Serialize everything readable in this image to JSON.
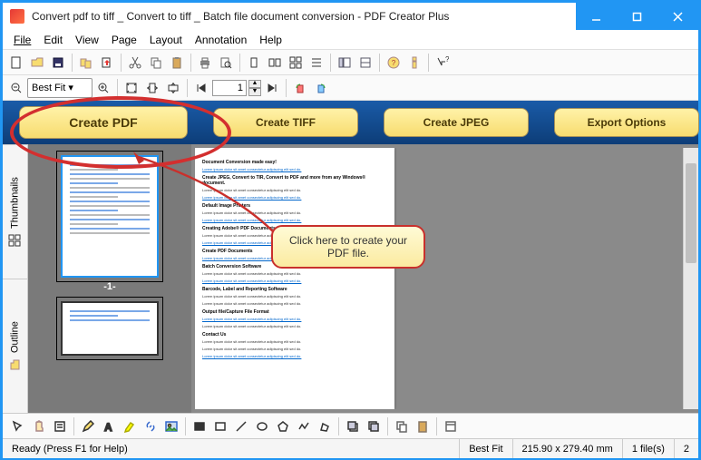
{
  "window": {
    "title": "Convert pdf to tiff _ Convert to tiff _ Batch file document conversion - PDF Creator Plus"
  },
  "menu": {
    "file": "File",
    "edit": "Edit",
    "view": "View",
    "page": "Page",
    "layout": "Layout",
    "annotation": "Annotation",
    "help": "Help"
  },
  "toolbar2": {
    "page_value": "1"
  },
  "actions": {
    "create_pdf": "Create PDF",
    "create_tiff": "Create TIFF",
    "create_jpeg": "Create JPEG",
    "export_options": "Export Options"
  },
  "side_tabs": {
    "thumbnails": "Thumbnails",
    "outline": "Outline"
  },
  "thumbs": {
    "page1_label": "-1-"
  },
  "callout": {
    "text": "Click here to create your PDF file."
  },
  "doc": {
    "h1": "Document Conversion made easy!",
    "h2": "Create JPEG, Convert to TIR, Convert to PDF and more from any Windows® document.",
    "p1": "Lorem ipsum dolor sit amet consectetur adipiscing elit sed do.",
    "h3": "Default Image Printers",
    "h4": "Creating Adobe® PDF Documents",
    "h5": "Create PDF Documents",
    "h6": "Batch Conversion Software",
    "h7": "Barcode, Label and Reporting Software",
    "h8": "Output file/Capture File Format",
    "h9": "Contact Us"
  },
  "status": {
    "ready": "Ready (Press F1 for Help)",
    "fit": "Best Fit",
    "dims": "215.90 x 279.40 mm",
    "files": "1 file(s)",
    "pages": "2"
  }
}
